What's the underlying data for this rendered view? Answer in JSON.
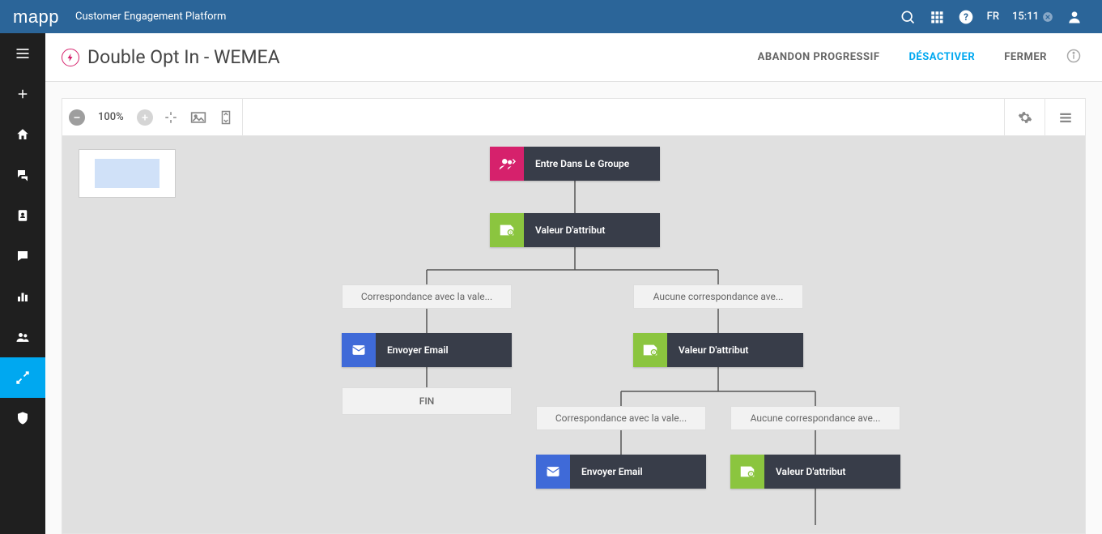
{
  "header": {
    "brand": "mapp",
    "subtitle": "Customer Engagement Platform",
    "lang": "FR",
    "time": "15:11"
  },
  "titlebar": {
    "title": "Double Opt In - WEMEA",
    "actions": {
      "abandon": "ABANDON PROGRESSIF",
      "disable": "DÉSACTIVER",
      "close": "FERMER"
    }
  },
  "toolbar": {
    "zoom": "100%"
  },
  "nodes": {
    "trigger": "Entre Dans Le Groupe",
    "attr1": "Valeur D'attribut",
    "branch_match": "Correspondance avec la vale...",
    "branch_nomatch": "Aucune correspondance ave...",
    "email": "Envoyer Email",
    "attr2": "Valeur D'attribut",
    "end": "FIN",
    "branch_match2": "Correspondance avec la vale...",
    "branch_nomatch2": "Aucune correspondance ave...",
    "email2": "Envoyer Email",
    "attr3": "Valeur D'attribut"
  }
}
